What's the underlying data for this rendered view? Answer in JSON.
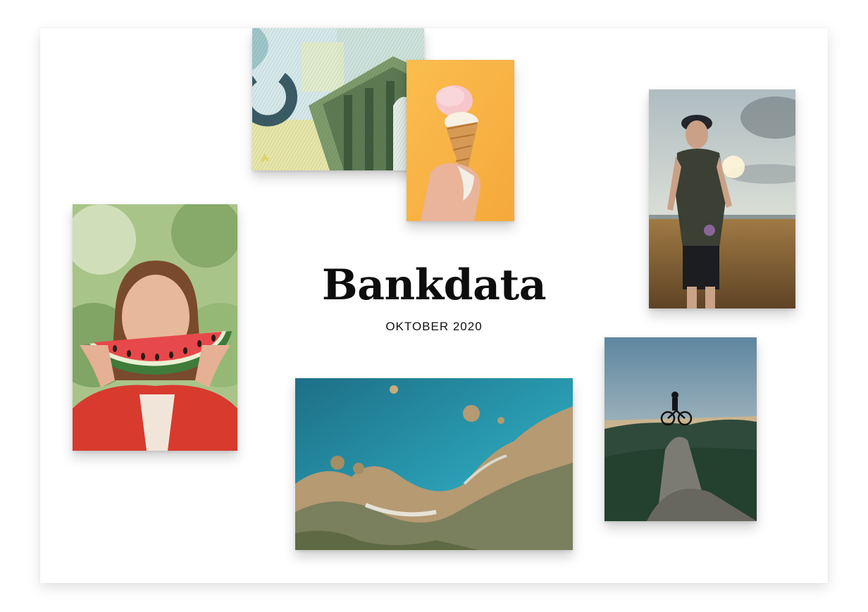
{
  "brand": {
    "name": "Bankdata",
    "date": "OKTOBER 2020"
  },
  "photos": [
    {
      "icon": "banknote-image"
    },
    {
      "icon": "ice-cream-image"
    },
    {
      "icon": "man-in-field-image"
    },
    {
      "icon": "woman-watermelon-image"
    },
    {
      "icon": "coastline-aerial-image"
    },
    {
      "icon": "cyclist-mountain-image"
    }
  ],
  "colors": {
    "text": "#0d0d0d",
    "background": "#ffffff"
  }
}
